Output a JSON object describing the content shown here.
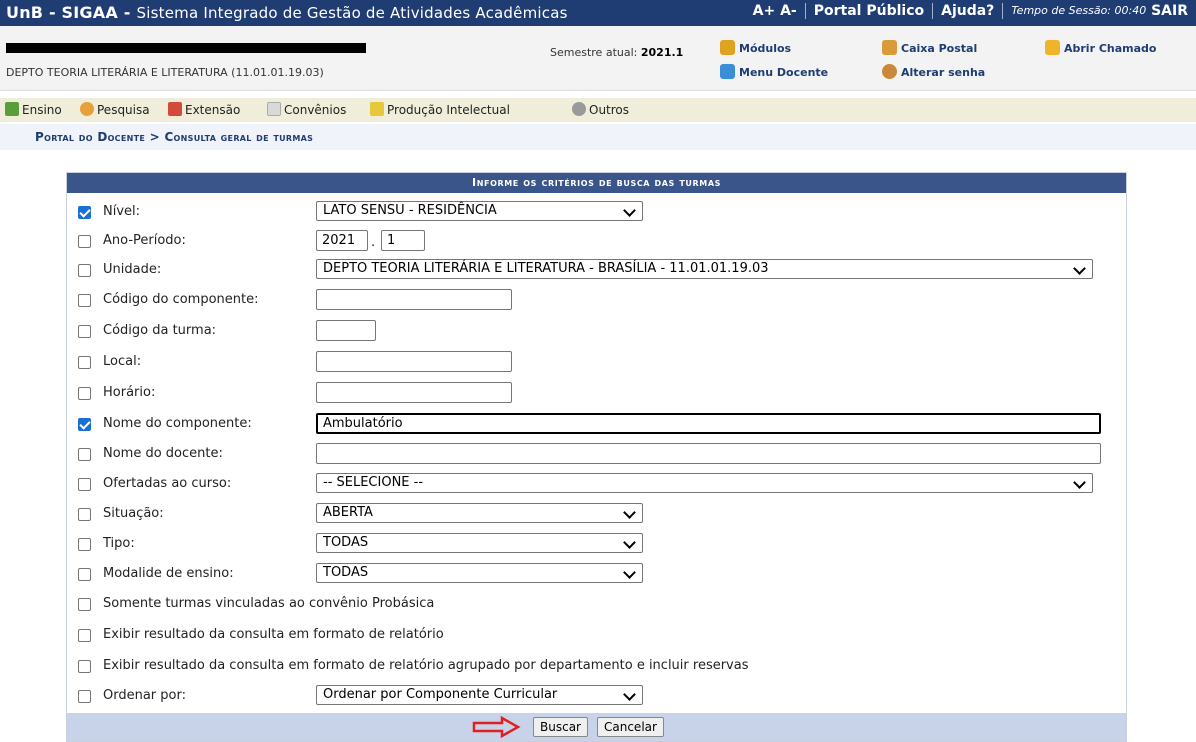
{
  "header": {
    "system_name": "UnB - SIGAA -",
    "system_desc": "Sistema Integrado de Gestão de Atividades Acadêmicas",
    "font_increase": "A+",
    "font_decrease": "A-",
    "portal_link": "Portal Público",
    "help_link": "Ajuda?",
    "session_time": "Tempo de Sessão: 00:40",
    "logout": "SAIR"
  },
  "user": {
    "department": "DEPTO TEORIA LITERÁRIA E LITERATURA (11.01.01.19.03)",
    "semester_label": "Semestre atual:",
    "semester_value": "2021.1"
  },
  "modules": {
    "modulos": "Módulos",
    "caixa_postal": "Caixa Postal",
    "abrir_chamado": "Abrir Chamado",
    "menu_docente": "Menu Docente",
    "alterar_senha": "Alterar senha"
  },
  "menu": {
    "ensino": "Ensino",
    "pesquisa": "Pesquisa",
    "extensao": "Extensão",
    "convenios": "Convênios",
    "producao": "Produção Intelectual",
    "outros": "Outros"
  },
  "breadcrumb": "Portal do Docente > Consulta geral de turmas",
  "form": {
    "title": "Informe os critérios de busca das turmas",
    "nivel_label": "Nível:",
    "nivel_value": "LATO SENSU - RESIDÊNCIA",
    "ano_label": "Ano-Período:",
    "ano_value": "2021",
    "periodo_value": "1",
    "unidade_label": "Unidade:",
    "unidade_value": "DEPTO TEORIA LITERÁRIA E LITERATURA - BRASÍLIA - 11.01.01.19.03",
    "codigo_componente_label": "Código do componente:",
    "codigo_turma_label": "Código da turma:",
    "local_label": "Local:",
    "horario_label": "Horário:",
    "nome_componente_label": "Nome do componente:",
    "nome_componente_value": "Ambulatório",
    "nome_docente_label": "Nome do docente:",
    "ofertadas_label": "Ofertadas ao curso:",
    "ofertadas_value": "-- SELECIONE --",
    "situacao_label": "Situação:",
    "situacao_value": "ABERTA",
    "tipo_label": "Tipo:",
    "tipo_value": "TODAS",
    "modalidade_label": "Modalide de ensino:",
    "modalidade_value": "TODAS",
    "probasica_label": "Somente turmas vinculadas ao convênio Probásica",
    "relatorio_label": "Exibir resultado da consulta em formato de relatório",
    "relatorio_depto_label": "Exibir resultado da consulta em formato de relatório agrupado por departamento e incluir reservas",
    "ordenar_label": "Ordenar por:",
    "ordenar_value": "Ordenar por Componente Curricular",
    "buscar": "Buscar",
    "cancelar": "Cancelar"
  },
  "colors": {
    "header_bg": "#1f3c73",
    "form_head_bg": "#3a5589",
    "footer_bg": "#c8d3ea",
    "checkbox_on": "#1a6fd4",
    "arrow": "#e02020"
  },
  "checked": {
    "nivel": true,
    "nome_componente": true
  }
}
